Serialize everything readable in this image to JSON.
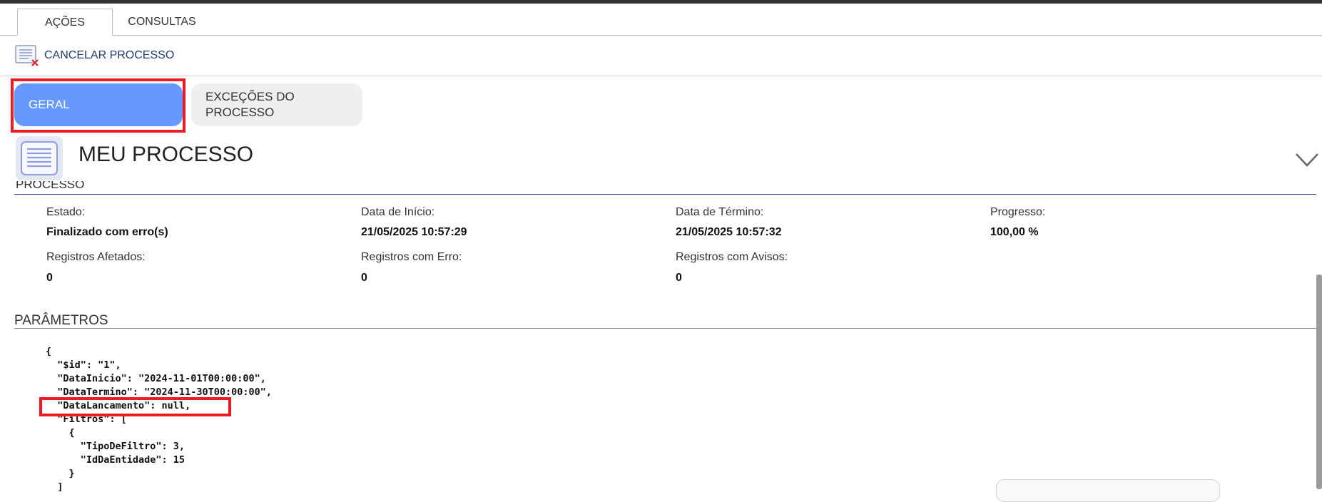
{
  "tabs": [
    {
      "label": "AÇÕES",
      "active": true
    },
    {
      "label": "CONSULTAS",
      "active": false
    }
  ],
  "toolbar": {
    "cancel_label": "CANCELAR PROCESSO",
    "icon": "document-cancel-icon"
  },
  "sections": {
    "geral_label": "GERAL",
    "excecoes_label": "EXCEÇÕES DO PROCESSO",
    "excecoes_line1": "EXCEÇÕES DO",
    "excecoes_line2": "PROCESSO"
  },
  "header": {
    "title": "MEU PROCESSO",
    "icon": "document-list-icon",
    "toggle_icon": "chevron-down-icon"
  },
  "processo": {
    "section_title": "PROCESSO",
    "fields": [
      {
        "label": "Estado:",
        "value": "Finalizado com erro(s)"
      },
      {
        "label": "Data de Início:",
        "value": "21/05/2025 10:57:29"
      },
      {
        "label": "Data de Término:",
        "value": "21/05/2025 10:57:32"
      },
      {
        "label": "Progresso:",
        "value": "100,00 %"
      },
      {
        "label": "Registros Afetados:",
        "value": "0"
      },
      {
        "label": "Registros com Erro:",
        "value": "0"
      },
      {
        "label": "Registros com Avisos:",
        "value": "0"
      }
    ]
  },
  "parametros": {
    "title": "PARÂMETROS",
    "code": "{\n  \"$id\": \"1\",\n  \"DataInicio\": \"2024-11-01T00:00:00\",\n  \"DataTermino\": \"2024-11-30T00:00:00\",\n  \"DataLancamento\": null,\n  \"Filtros\": [\n    {\n      \"TipoDeFiltro\": 3,\n      \"IdDaEntidade\": 15\n    }\n  ]"
  },
  "colors": {
    "accent": "#6699ff",
    "highlight": "#ec1c24",
    "link": "#1e3a6e"
  }
}
